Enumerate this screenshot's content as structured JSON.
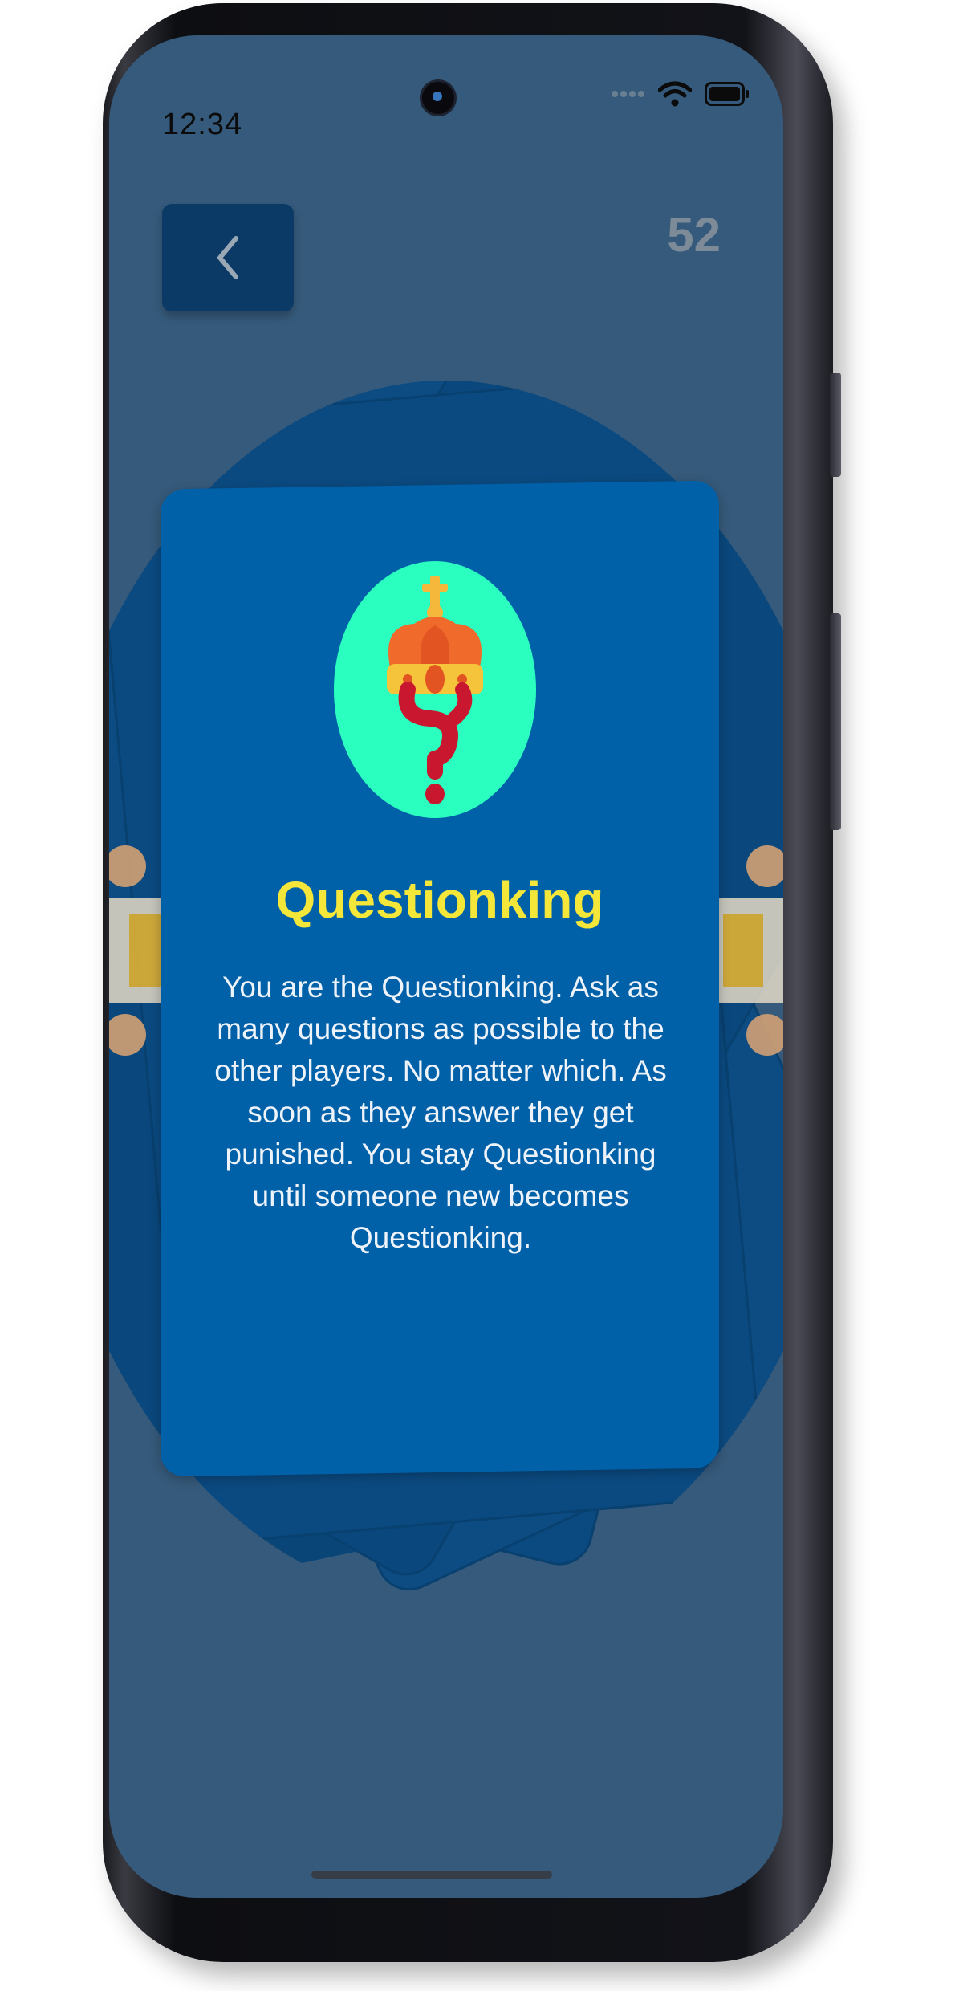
{
  "status_bar": {
    "time": "12:34",
    "icons": [
      "signal-dots-icon",
      "wifi-icon",
      "battery-icon"
    ]
  },
  "header": {
    "back_icon": "chevron-left-icon",
    "card_count": "52"
  },
  "card": {
    "icon": "crowned-question-mark-icon",
    "title": "Questionking",
    "description": "You are the Questionking. Ask as many questions as possible to the other players. No matter which. As soon as they answer they get punished. You stay Questionking until someone new becomes Questionking."
  },
  "colors": {
    "background": "#365a7b",
    "card_stack": "#0b4a80",
    "card": "#0060a8",
    "back_button": "#0b3a67",
    "title": "#f4e739",
    "icon_circle": "#2bffc0",
    "counter": "#7d8b99"
  }
}
